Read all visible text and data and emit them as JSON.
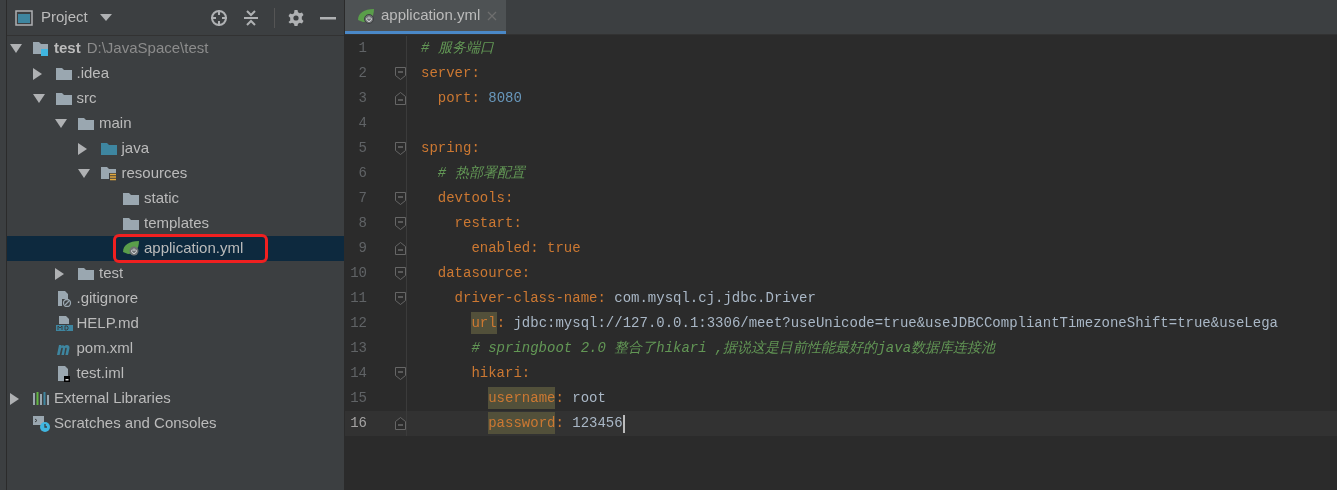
{
  "project_panel": {
    "title": "Project",
    "tree": [
      {
        "name": "test",
        "detail": "D:\\JavaSpace\\test",
        "kind": "module",
        "expanded": true,
        "selected": false,
        "children": [
          {
            "name": ".idea",
            "kind": "folder",
            "expanded": false,
            "selected": false
          },
          {
            "name": "src",
            "kind": "folder",
            "expanded": true,
            "selected": false,
            "children": [
              {
                "name": "main",
                "kind": "folder",
                "expanded": true,
                "selected": false,
                "children": [
                  {
                    "name": "java",
                    "kind": "source-folder",
                    "expanded": false,
                    "selected": false
                  },
                  {
                    "name": "resources",
                    "kind": "resources-folder",
                    "expanded": true,
                    "selected": false,
                    "children": [
                      {
                        "name": "static",
                        "kind": "folder",
                        "selected": false
                      },
                      {
                        "name": "templates",
                        "kind": "folder",
                        "selected": false
                      },
                      {
                        "name": "application.yml",
                        "kind": "yaml",
                        "selected": true,
                        "boxed": true
                      }
                    ]
                  }
                ]
              },
              {
                "name": "test",
                "kind": "folder",
                "expanded": false,
                "selected": false
              }
            ]
          },
          {
            "name": ".gitignore",
            "kind": "ignore-file",
            "selected": false
          },
          {
            "name": "HELP.md",
            "kind": "markdown",
            "selected": false
          },
          {
            "name": "pom.xml",
            "kind": "maven",
            "selected": false
          },
          {
            "name": "test.iml",
            "kind": "iml",
            "selected": false
          }
        ]
      },
      {
        "name": "External Libraries",
        "kind": "libraries",
        "expanded": false,
        "selected": false
      },
      {
        "name": "Scratches and Consoles",
        "kind": "scratches",
        "selected": false
      }
    ]
  },
  "editor": {
    "tab": {
      "label": "application.yml",
      "selected": true
    },
    "lines": [
      {
        "number": "1",
        "kind": "plain",
        "current": false,
        "tokens": [
          {
            "kind": "comment",
            "text": "# 服务端口"
          }
        ]
      },
      {
        "number": "2",
        "kind": "fold-start",
        "current": false,
        "tokens": [
          {
            "kind": "key",
            "text": "server"
          },
          {
            "kind": "punct",
            "text": ":"
          }
        ]
      },
      {
        "number": "3",
        "kind": "fold-end",
        "current": false,
        "tokens": [
          {
            "kind": "key",
            "text": "  port"
          },
          {
            "kind": "punct",
            "text": ": "
          },
          {
            "kind": "number",
            "text": "8080"
          }
        ]
      },
      {
        "number": "4",
        "kind": "plain",
        "current": false
      },
      {
        "number": "5",
        "kind": "fold-start",
        "current": false,
        "tokens": [
          {
            "kind": "key",
            "text": "spring"
          },
          {
            "kind": "punct",
            "text": ":"
          }
        ]
      },
      {
        "number": "6",
        "kind": "plain",
        "current": false,
        "tokens": [
          {
            "kind": "comment",
            "text": "  # 热部署配置"
          }
        ]
      },
      {
        "number": "7",
        "kind": "fold-start",
        "current": false,
        "tokens": [
          {
            "kind": "key",
            "text": "  devtools"
          },
          {
            "kind": "punct",
            "text": ":"
          }
        ]
      },
      {
        "number": "8",
        "kind": "fold-start",
        "current": false,
        "tokens": [
          {
            "kind": "key",
            "text": "    restart"
          },
          {
            "kind": "punct",
            "text": ":"
          }
        ]
      },
      {
        "number": "9",
        "kind": "fold-end",
        "current": false,
        "tokens": [
          {
            "kind": "key",
            "text": "      enabled"
          },
          {
            "kind": "punct",
            "text": ": "
          },
          {
            "kind": "key",
            "text": "true"
          }
        ]
      },
      {
        "number": "10",
        "kind": "fold-start",
        "current": false,
        "tokens": [
          {
            "kind": "key",
            "text": "  datasource"
          },
          {
            "kind": "punct",
            "text": ":"
          }
        ]
      },
      {
        "number": "11",
        "kind": "fold-start",
        "current": false,
        "tokens": [
          {
            "kind": "key",
            "text": "    driver-class-name"
          },
          {
            "kind": "punct",
            "text": ": "
          },
          {
            "kind": "value",
            "text": "com.mysql.cj.jdbc.Driver"
          }
        ]
      },
      {
        "number": "12",
        "kind": "plain",
        "current": false,
        "tokens": [
          {
            "kind": "key",
            "text": "      url",
            "highlighted": true
          },
          {
            "kind": "punct",
            "text": ": "
          },
          {
            "kind": "value",
            "text": "jdbc:mysql://127.0.0.1:3306/meet?useUnicode=true&useJDBCCompliantTimezoneShift=true&useLega"
          }
        ]
      },
      {
        "number": "13",
        "kind": "plain",
        "current": false,
        "tokens": [
          {
            "kind": "comment",
            "text": "      # springboot 2.0 整合了hikari ,据说这是目前性能最好的java数据库连接池"
          }
        ]
      },
      {
        "number": "14",
        "kind": "fold-start",
        "current": false,
        "tokens": [
          {
            "kind": "key",
            "text": "      hikari"
          },
          {
            "kind": "punct",
            "text": ":"
          }
        ]
      },
      {
        "number": "15",
        "kind": "plain",
        "current": false,
        "tokens": [
          {
            "kind": "key",
            "text": "        username",
            "highlighted": true
          },
          {
            "kind": "punct",
            "text": ": "
          },
          {
            "kind": "value",
            "text": "root"
          }
        ]
      },
      {
        "number": "16",
        "kind": "fold-end",
        "current": true,
        "tokens": [
          {
            "kind": "key",
            "text": "        password",
            "highlighted": true
          },
          {
            "kind": "punct",
            "text": ": "
          },
          {
            "kind": "value",
            "text": "123456"
          }
        ]
      }
    ]
  }
}
